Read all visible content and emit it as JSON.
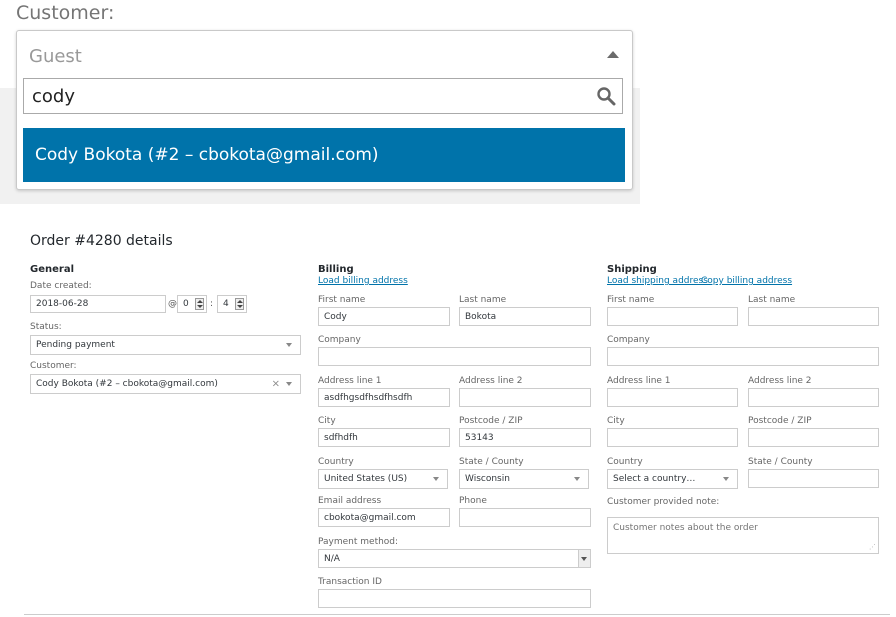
{
  "customer_widget": {
    "label": "Customer:",
    "selected_text": "Guest",
    "search_value": "cody",
    "result_text": "Cody Bokota (#2 – cbokota@gmail.com)",
    "highlight_color": "#0073aa",
    "icons": {
      "collapse": "caret-up-icon",
      "search": "search-icon"
    }
  },
  "order": {
    "title": "Order #4280 details",
    "general": {
      "heading": "General",
      "date_label": "Date created:",
      "date_value": "2018-06-28",
      "at_sign": "@",
      "hour_value": "0",
      "colon": ":",
      "minute_value": "4",
      "status_label": "Status:",
      "status_value": "Pending payment",
      "customer_label": "Customer:",
      "customer_value": "Cody Bokota (#2 – cbokota@gmail.com)",
      "clear_symbol": "×"
    },
    "billing": {
      "heading": "Billing",
      "load_link": "Load billing address",
      "first_name_label": "First name",
      "first_name_value": "Cody",
      "last_name_label": "Last name",
      "last_name_value": "Bokota",
      "company_label": "Company",
      "company_value": "",
      "address1_label": "Address line 1",
      "address1_value": "asdfhgsdfhsdfhsdfh",
      "address2_label": "Address line 2",
      "address2_value": "",
      "city_label": "City",
      "city_value": "sdfhdfh",
      "postcode_label": "Postcode / ZIP",
      "postcode_value": "53143",
      "country_label": "Country",
      "country_value": "United States (US)",
      "state_label": "State / County",
      "state_value": "Wisconsin",
      "email_label": "Email address",
      "email_value": "cbokota@gmail.com",
      "phone_label": "Phone",
      "phone_value": "",
      "payment_label": "Payment method:",
      "payment_value": "N/A",
      "transaction_label": "Transaction ID",
      "transaction_value": ""
    },
    "shipping": {
      "heading": "Shipping",
      "load_link": "Load shipping address",
      "copy_link": "Copy billing address",
      "first_name_label": "First name",
      "last_name_label": "Last name",
      "company_label": "Company",
      "address1_label": "Address line 1",
      "address2_label": "Address line 2",
      "city_label": "City",
      "postcode_label": "Postcode / ZIP",
      "country_label": "Country",
      "country_value": "Select a country…",
      "state_label": "State / County",
      "note_label": "Customer provided note:",
      "note_placeholder": "Customer notes about the order"
    }
  }
}
